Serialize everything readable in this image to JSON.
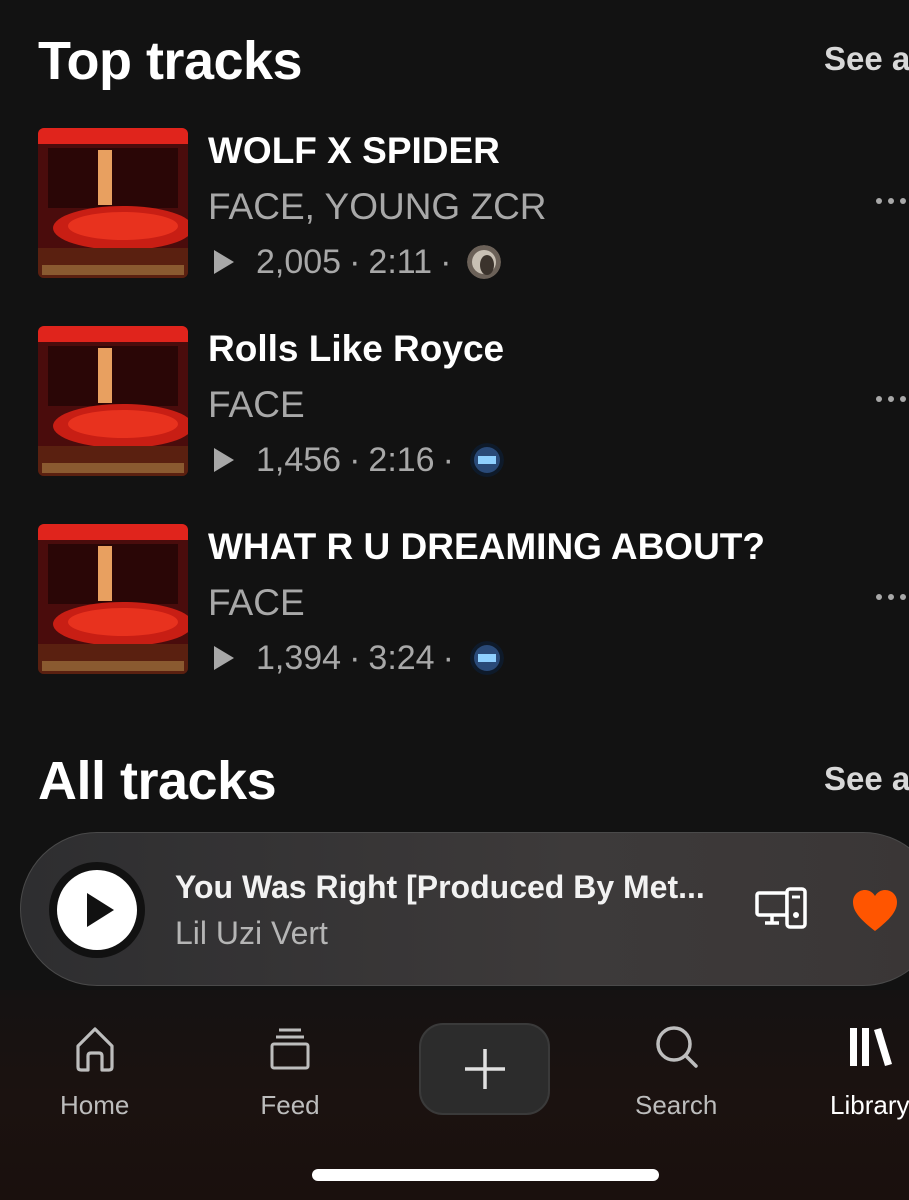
{
  "top_tracks": {
    "title": "Top tracks",
    "see_all": "See a",
    "tracks": [
      {
        "title": "WOLF X SPIDER",
        "artist": "FACE, YOUNG ZCR",
        "plays": "2,005",
        "duration": "2:11",
        "sep1": "·",
        "sep2": "·",
        "avatar": "user-avatar-photo"
      },
      {
        "title": "Rolls Like Royce",
        "artist": "FACE",
        "plays": "1,456",
        "duration": "2:16",
        "sep1": "·",
        "sep2": "·",
        "avatar": "user-avatar-jtk"
      },
      {
        "title": "WHAT R U DREAMING ABOUT?",
        "artist": "FACE",
        "plays": "1,394",
        "duration": "3:24",
        "sep1": "·",
        "sep2": "·",
        "avatar": "user-avatar-jtk"
      }
    ]
  },
  "all_tracks": {
    "title": "All tracks",
    "see_all": "See a"
  },
  "mini_player": {
    "title": "You Was Right [Produced By Met...",
    "artist": "Lil Uzi Vert",
    "liked": true,
    "heart_color": "#ff5500"
  },
  "bottom_nav": {
    "items": [
      {
        "label": "Home",
        "icon": "home-icon"
      },
      {
        "label": "Feed",
        "icon": "feed-icon"
      },
      {
        "label": "",
        "icon": "plus-icon"
      },
      {
        "label": "Search",
        "icon": "search-icon"
      },
      {
        "label": "Library",
        "icon": "library-icon",
        "active": true
      }
    ]
  },
  "colors": {
    "background": "#121212",
    "accent": "#ff5500",
    "secondary_text": "#a8a8a8"
  }
}
